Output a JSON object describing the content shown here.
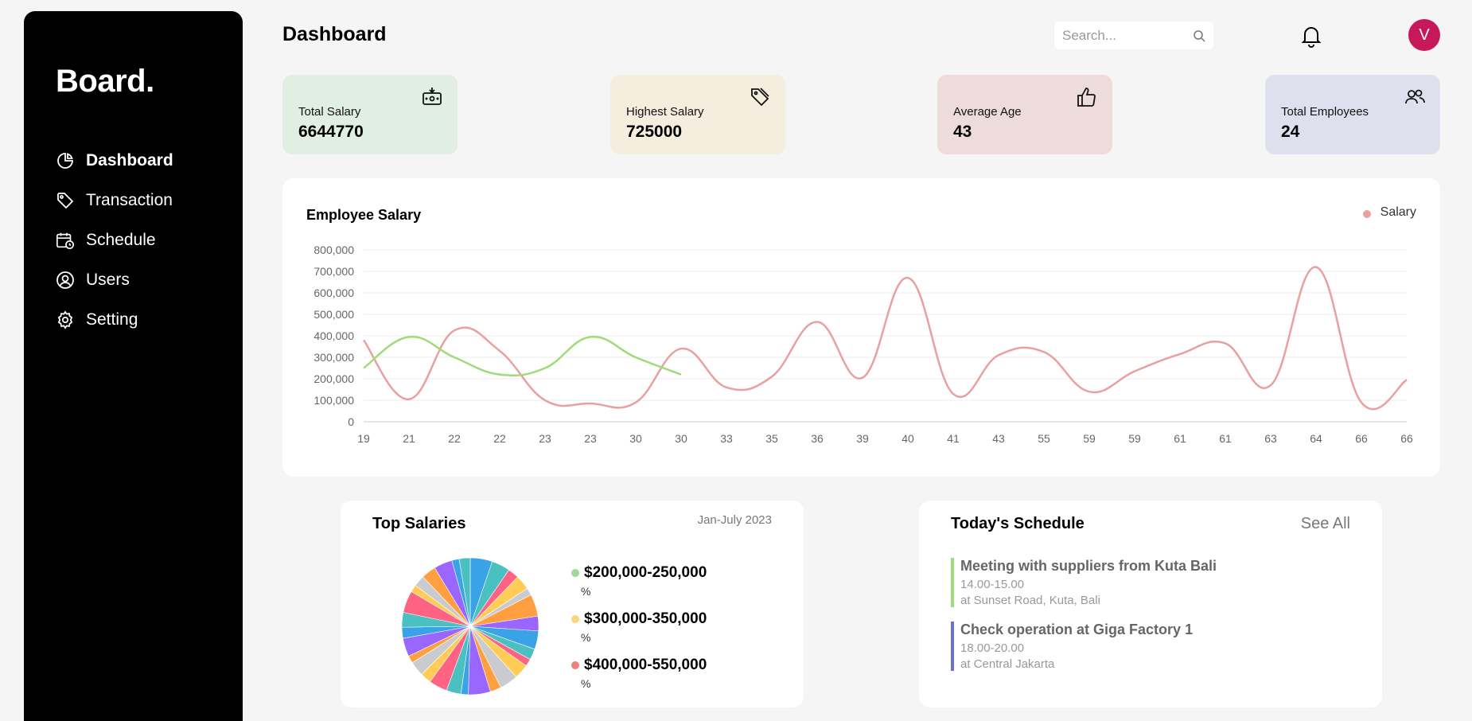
{
  "sidebar": {
    "brand": "Board.",
    "items": [
      {
        "label": "Dashboard",
        "icon": "pie-chart-icon",
        "active": true
      },
      {
        "label": "Transaction",
        "icon": "tag-icon"
      },
      {
        "label": "Schedule",
        "icon": "calendar-clock-icon"
      },
      {
        "label": "Users",
        "icon": "user-circle-icon"
      },
      {
        "label": "Setting",
        "icon": "gear-icon"
      }
    ]
  },
  "header": {
    "title": "Dashboard",
    "search_placeholder": "Search...",
    "avatar_initial": "V"
  },
  "stats": [
    {
      "label": "Total Salary",
      "value": "6644770",
      "bg": "#e0efe2",
      "icon": "money-icon"
    },
    {
      "label": "Highest Salary",
      "value": "725000",
      "bg": "#f5eddd",
      "icon": "tag-icon"
    },
    {
      "label": "Average Age",
      "value": "43",
      "bg": "#eedbdb",
      "icon": "thumbs-up-icon"
    },
    {
      "label": "Total Employees",
      "value": "24",
      "bg": "#dfe0ee",
      "icon": "users-icon"
    }
  ],
  "salary_chart": {
    "title": "Employee Salary",
    "legend_label": "Salary",
    "legend_color": "#e8a0a0"
  },
  "chart_data": {
    "type": "line",
    "title": "Employee Salary",
    "xlabel": "",
    "ylabel": "",
    "ylim": [
      0,
      800000
    ],
    "yticks": [
      "0",
      "100,000",
      "200,000",
      "300,000",
      "400,000",
      "500,000",
      "600,000",
      "700,000",
      "800,000"
    ],
    "categories": [
      "19",
      "21",
      "22",
      "22",
      "23",
      "23",
      "30",
      "30",
      "33",
      "35",
      "36",
      "39",
      "40",
      "41",
      "43",
      "55",
      "59",
      "59",
      "61",
      "61",
      "63",
      "64",
      "66",
      "66"
    ],
    "series": [
      {
        "name": "Salary",
        "color": "#e8a0a0",
        "values": [
          380000,
          105000,
          425000,
          330000,
          100000,
          85000,
          90000,
          340000,
          160000,
          210000,
          465000,
          205000,
          670000,
          130000,
          310000,
          325000,
          140000,
          235000,
          315000,
          365000,
          170000,
          720000,
          90000,
          195000
        ]
      },
      {
        "color": "#9edc7a",
        "values": [
          250000,
          395000,
          300000,
          220000,
          250000,
          395000,
          300000,
          220000
        ]
      }
    ],
    "grid": true,
    "legend": "top-right"
  },
  "top_salaries": {
    "title": "Top Salaries",
    "date_range": "Jan-July 2023",
    "legend": [
      {
        "label": "$200,000-250,000",
        "pct": "%",
        "color": "#9fd89a"
      },
      {
        "label": "$300,000-350,000",
        "pct": "%",
        "color": "#fbd47a"
      },
      {
        "label": "$400,000-550,000",
        "pct": "%",
        "color": "#ef8080"
      }
    ],
    "pie_colors": [
      "#3aa3e8",
      "#ff9f40",
      "#ffcd56",
      "#4bc0c0",
      "#9966ff",
      "#c9cbcf",
      "#ff6384"
    ]
  },
  "schedule": {
    "title": "Today's Schedule",
    "see_all": "See All",
    "items": [
      {
        "title": "Meeting with suppliers from Kuta Bali",
        "time": "14.00-15.00",
        "location": "at Sunset Road, Kuta, Bali",
        "color": "#9edc7a"
      },
      {
        "title": "Check operation at Giga Factory 1",
        "time": "18.00-20.00",
        "location": "at Central Jakarta",
        "color": "#6b72c9"
      }
    ]
  }
}
